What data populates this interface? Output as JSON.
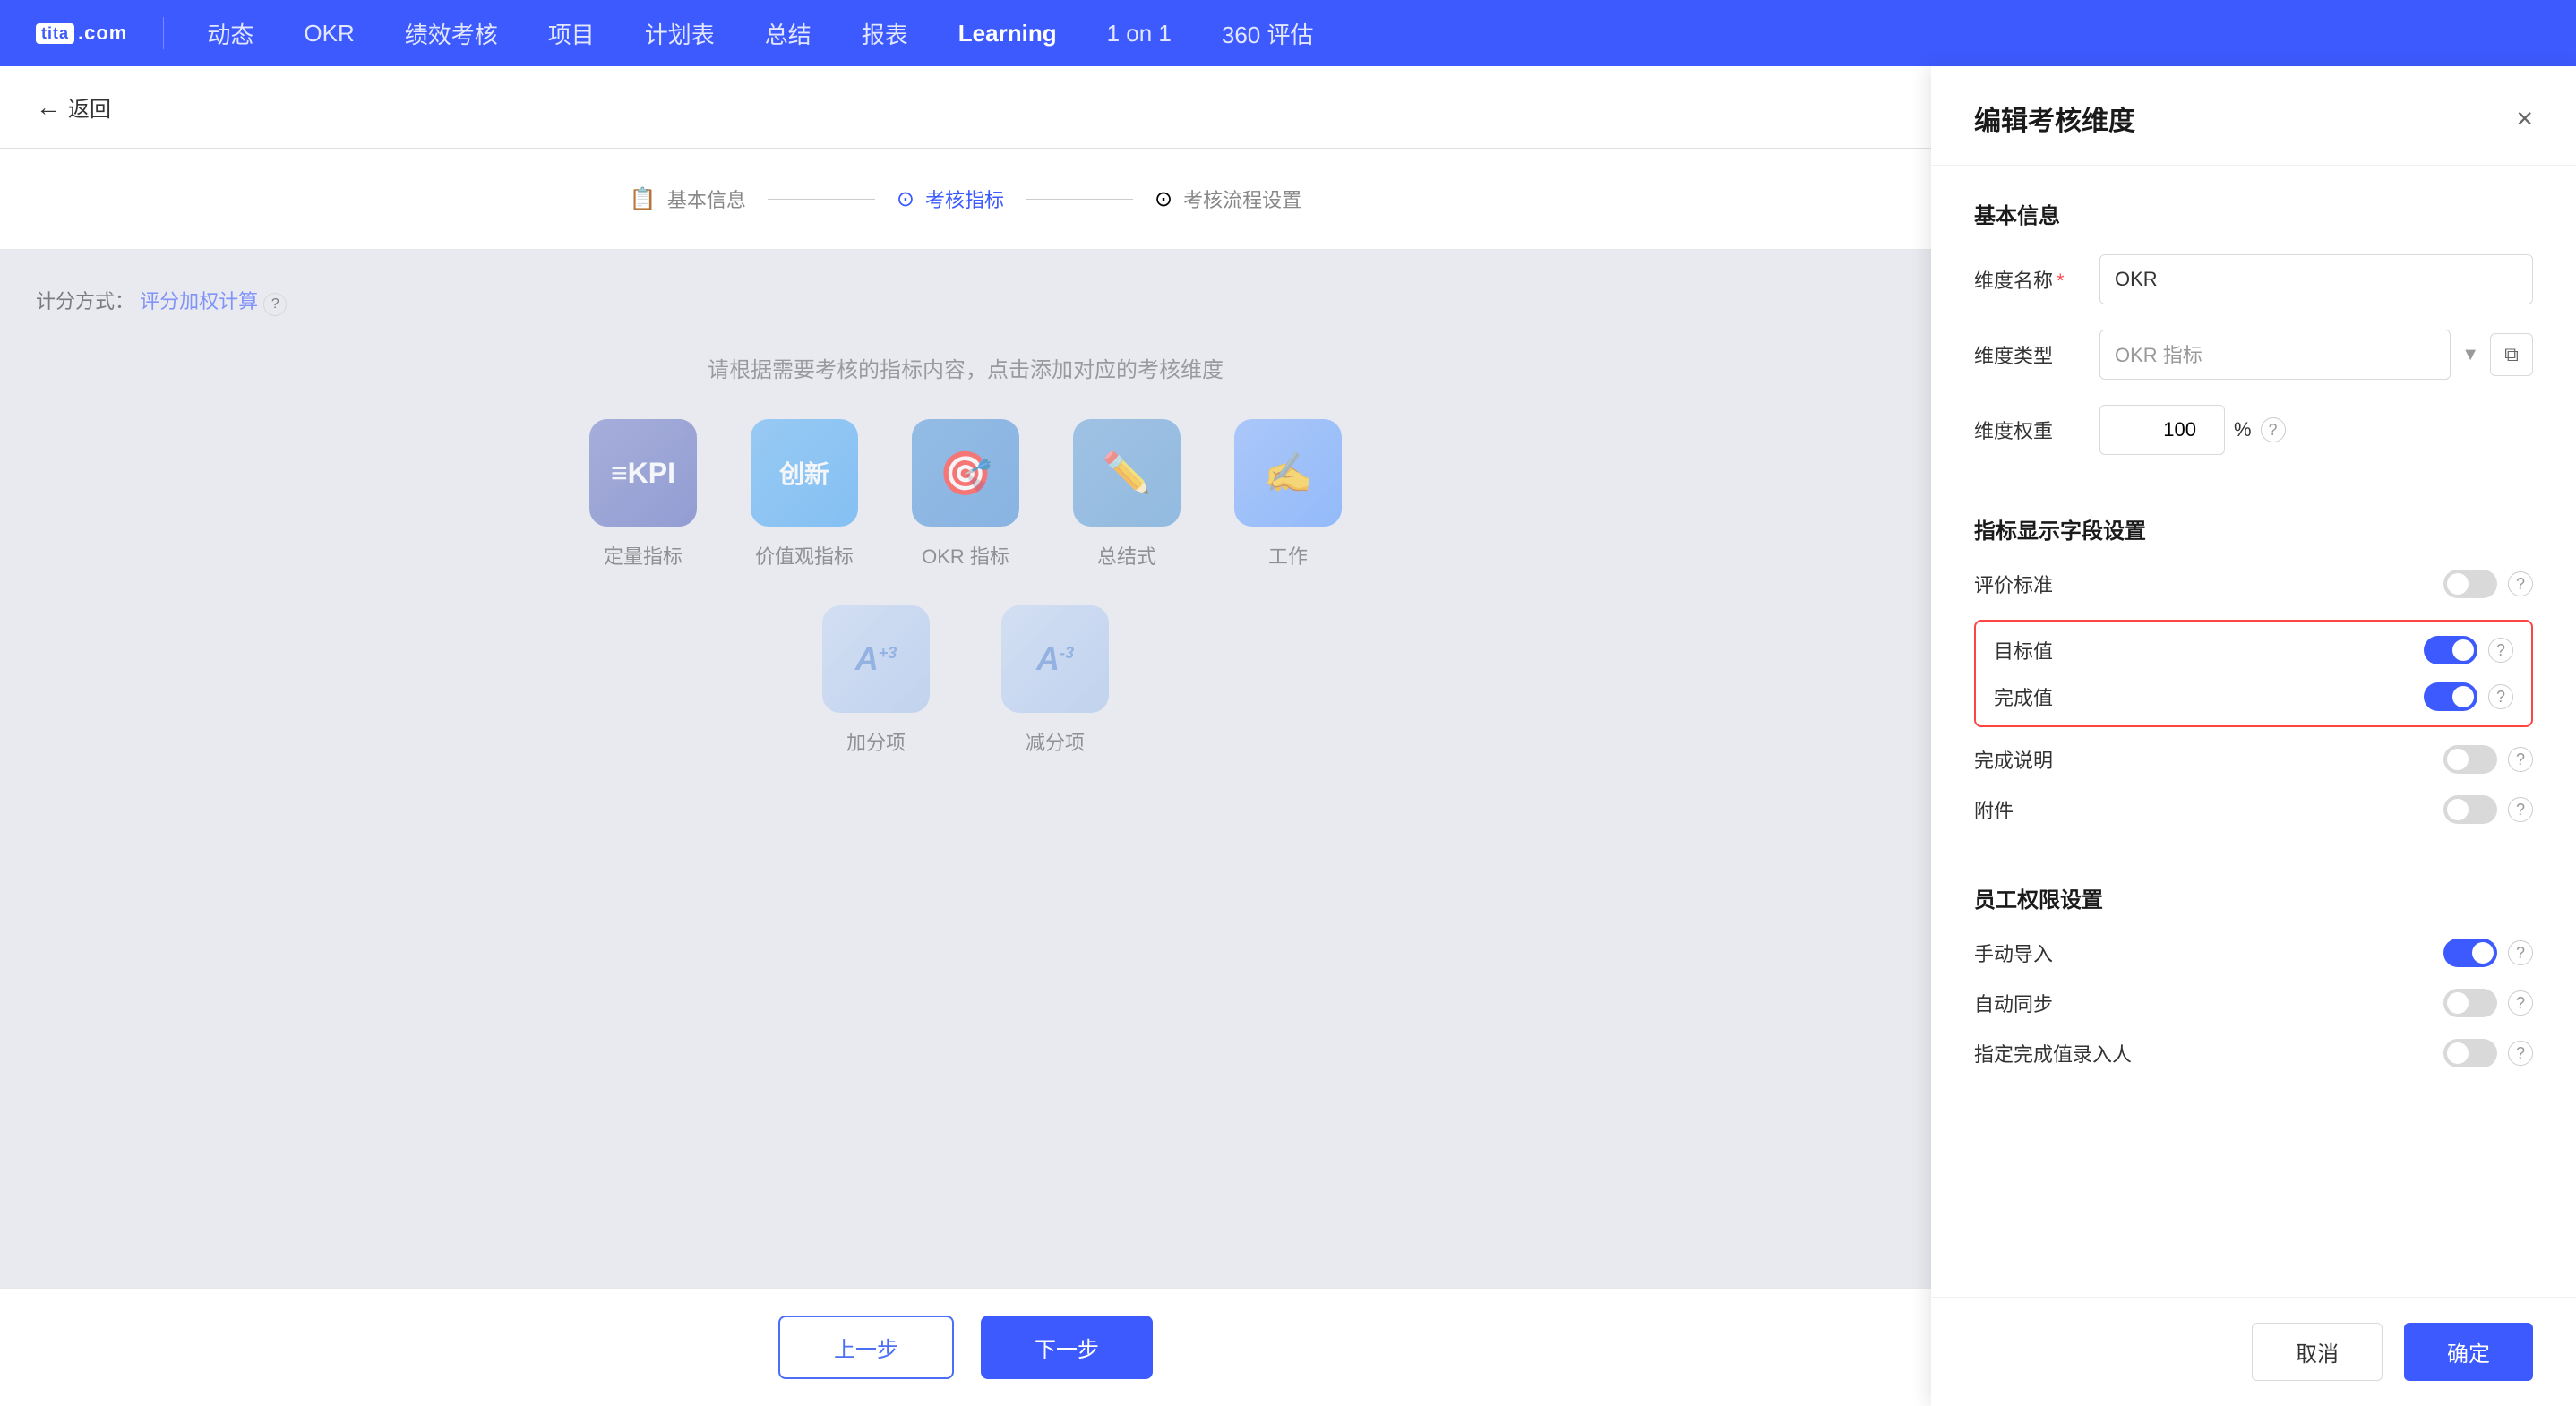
{
  "nav": {
    "logo": "tita",
    "logo_suffix": ".com",
    "items": [
      {
        "id": "dongtai",
        "label": "动态"
      },
      {
        "id": "okr",
        "label": "OKR"
      },
      {
        "id": "jixiao",
        "label": "绩效考核"
      },
      {
        "id": "xiangmu",
        "label": "项目"
      },
      {
        "id": "jihuabiao",
        "label": "计划表"
      },
      {
        "id": "zongji",
        "label": "总结"
      },
      {
        "id": "baobiao",
        "label": "报表"
      },
      {
        "id": "learning",
        "label": "Learning",
        "active": true
      },
      {
        "id": "1on1",
        "label": "1 on 1"
      },
      {
        "id": "360",
        "label": "360 评估"
      }
    ]
  },
  "back": {
    "label": "返回"
  },
  "stepper": {
    "steps": [
      {
        "id": "basic",
        "icon": "📋",
        "label": "基本信息"
      },
      {
        "id": "index",
        "icon": "⊙",
        "label": "考核指标",
        "active": true
      },
      {
        "id": "flow",
        "icon": "⊙",
        "label": "考核流程设置"
      }
    ]
  },
  "main": {
    "scoring_label": "计分方式：",
    "scoring_value": "评分加权计算",
    "help_text": "请根据需要考核的指标内容，点击添加对应的考核维度",
    "icons": [
      {
        "id": "dingliangzhibiao",
        "type": "kpi",
        "icon": "KPI",
        "label": "定量指标"
      },
      {
        "id": "jiazhi",
        "type": "chuangxin",
        "icon": "创新",
        "label": "价值观指标"
      },
      {
        "id": "okr_zhibiao",
        "type": "okr",
        "icon": "🎯",
        "label": "OKR 指标"
      },
      {
        "id": "zongjishi",
        "type": "zongji",
        "icon": "✏️",
        "label": "总结式"
      },
      {
        "id": "gongzuo",
        "type": "gongzuo",
        "icon": "✍",
        "label": "工作"
      }
    ],
    "bonus_icons": [
      {
        "id": "jiafenxiang",
        "label": "加分项",
        "icon": "A+3"
      },
      {
        "id": "jianfenxiang",
        "label": "减分项",
        "icon": "A-3"
      }
    ]
  },
  "bottom_buttons": {
    "prev": "上一步",
    "next": "下一步"
  },
  "panel": {
    "title": "编辑考核维度",
    "close_label": "×",
    "sections": {
      "basic_info": {
        "title": "基本信息",
        "fields": {
          "name": {
            "label": "维度名称",
            "value": "OKR",
            "placeholder": ""
          },
          "type": {
            "label": "维度类型",
            "value": "OKR 指标",
            "placeholder": "OKR 指标"
          },
          "weight": {
            "label": "维度权重",
            "value": "100",
            "unit": "%"
          }
        }
      },
      "indicator_settings": {
        "title": "指标显示字段设置",
        "toggles": [
          {
            "id": "evaluation_standard",
            "label": "评价标准",
            "on": false
          },
          {
            "id": "target_value",
            "label": "目标值",
            "on": true,
            "highlighted": true
          },
          {
            "id": "completion_value",
            "label": "完成值",
            "on": true,
            "highlighted": true
          },
          {
            "id": "completion_note",
            "label": "完成说明",
            "on": false
          },
          {
            "id": "attachment",
            "label": "附件",
            "on": false
          }
        ]
      },
      "employee_permissions": {
        "title": "员工权限设置",
        "toggles": [
          {
            "id": "manual_import",
            "label": "手动导入",
            "on": true
          },
          {
            "id": "auto_sync",
            "label": "自动同步",
            "on": false
          },
          {
            "id": "designate_completion",
            "label": "指定完成值录入人",
            "on": false
          }
        ]
      }
    },
    "footer": {
      "cancel": "取消",
      "confirm": "确定"
    }
  }
}
